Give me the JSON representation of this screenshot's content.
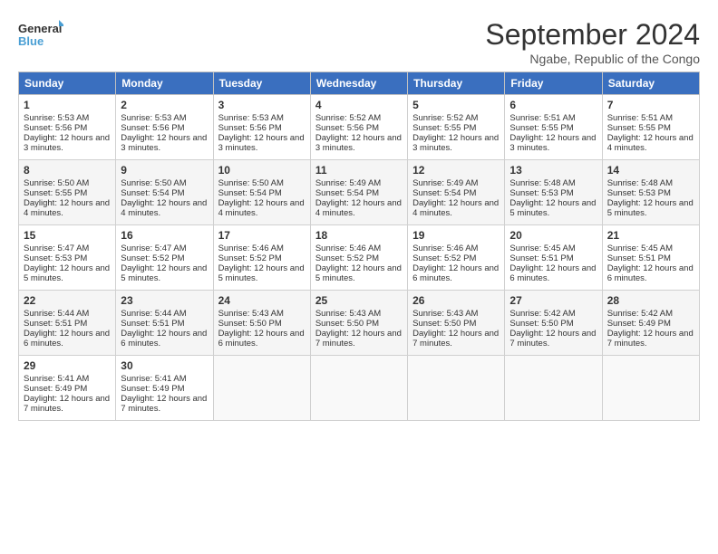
{
  "logo": {
    "line1": "General",
    "line2": "Blue"
  },
  "title": "September 2024",
  "subtitle": "Ngabe, Republic of the Congo",
  "headers": [
    "Sunday",
    "Monday",
    "Tuesday",
    "Wednesday",
    "Thursday",
    "Friday",
    "Saturday"
  ],
  "weeks": [
    [
      {
        "day": "1",
        "sunrise": "5:53 AM",
        "sunset": "5:56 PM",
        "daylight": "12 hours and 3 minutes."
      },
      {
        "day": "2",
        "sunrise": "5:53 AM",
        "sunset": "5:56 PM",
        "daylight": "12 hours and 3 minutes."
      },
      {
        "day": "3",
        "sunrise": "5:53 AM",
        "sunset": "5:56 PM",
        "daylight": "12 hours and 3 minutes."
      },
      {
        "day": "4",
        "sunrise": "5:52 AM",
        "sunset": "5:56 PM",
        "daylight": "12 hours and 3 minutes."
      },
      {
        "day": "5",
        "sunrise": "5:52 AM",
        "sunset": "5:55 PM",
        "daylight": "12 hours and 3 minutes."
      },
      {
        "day": "6",
        "sunrise": "5:51 AM",
        "sunset": "5:55 PM",
        "daylight": "12 hours and 3 minutes."
      },
      {
        "day": "7",
        "sunrise": "5:51 AM",
        "sunset": "5:55 PM",
        "daylight": "12 hours and 4 minutes."
      }
    ],
    [
      {
        "day": "8",
        "sunrise": "5:50 AM",
        "sunset": "5:55 PM",
        "daylight": "12 hours and 4 minutes."
      },
      {
        "day": "9",
        "sunrise": "5:50 AM",
        "sunset": "5:54 PM",
        "daylight": "12 hours and 4 minutes."
      },
      {
        "day": "10",
        "sunrise": "5:50 AM",
        "sunset": "5:54 PM",
        "daylight": "12 hours and 4 minutes."
      },
      {
        "day": "11",
        "sunrise": "5:49 AM",
        "sunset": "5:54 PM",
        "daylight": "12 hours and 4 minutes."
      },
      {
        "day": "12",
        "sunrise": "5:49 AM",
        "sunset": "5:54 PM",
        "daylight": "12 hours and 4 minutes."
      },
      {
        "day": "13",
        "sunrise": "5:48 AM",
        "sunset": "5:53 PM",
        "daylight": "12 hours and 5 minutes."
      },
      {
        "day": "14",
        "sunrise": "5:48 AM",
        "sunset": "5:53 PM",
        "daylight": "12 hours and 5 minutes."
      }
    ],
    [
      {
        "day": "15",
        "sunrise": "5:47 AM",
        "sunset": "5:53 PM",
        "daylight": "12 hours and 5 minutes."
      },
      {
        "day": "16",
        "sunrise": "5:47 AM",
        "sunset": "5:52 PM",
        "daylight": "12 hours and 5 minutes."
      },
      {
        "day": "17",
        "sunrise": "5:46 AM",
        "sunset": "5:52 PM",
        "daylight": "12 hours and 5 minutes."
      },
      {
        "day": "18",
        "sunrise": "5:46 AM",
        "sunset": "5:52 PM",
        "daylight": "12 hours and 5 minutes."
      },
      {
        "day": "19",
        "sunrise": "5:46 AM",
        "sunset": "5:52 PM",
        "daylight": "12 hours and 6 minutes."
      },
      {
        "day": "20",
        "sunrise": "5:45 AM",
        "sunset": "5:51 PM",
        "daylight": "12 hours and 6 minutes."
      },
      {
        "day": "21",
        "sunrise": "5:45 AM",
        "sunset": "5:51 PM",
        "daylight": "12 hours and 6 minutes."
      }
    ],
    [
      {
        "day": "22",
        "sunrise": "5:44 AM",
        "sunset": "5:51 PM",
        "daylight": "12 hours and 6 minutes."
      },
      {
        "day": "23",
        "sunrise": "5:44 AM",
        "sunset": "5:51 PM",
        "daylight": "12 hours and 6 minutes."
      },
      {
        "day": "24",
        "sunrise": "5:43 AM",
        "sunset": "5:50 PM",
        "daylight": "12 hours and 6 minutes."
      },
      {
        "day": "25",
        "sunrise": "5:43 AM",
        "sunset": "5:50 PM",
        "daylight": "12 hours and 7 minutes."
      },
      {
        "day": "26",
        "sunrise": "5:43 AM",
        "sunset": "5:50 PM",
        "daylight": "12 hours and 7 minutes."
      },
      {
        "day": "27",
        "sunrise": "5:42 AM",
        "sunset": "5:50 PM",
        "daylight": "12 hours and 7 minutes."
      },
      {
        "day": "28",
        "sunrise": "5:42 AM",
        "sunset": "5:49 PM",
        "daylight": "12 hours and 7 minutes."
      }
    ],
    [
      {
        "day": "29",
        "sunrise": "5:41 AM",
        "sunset": "5:49 PM",
        "daylight": "12 hours and 7 minutes."
      },
      {
        "day": "30",
        "sunrise": "5:41 AM",
        "sunset": "5:49 PM",
        "daylight": "12 hours and 7 minutes."
      },
      null,
      null,
      null,
      null,
      null
    ]
  ]
}
